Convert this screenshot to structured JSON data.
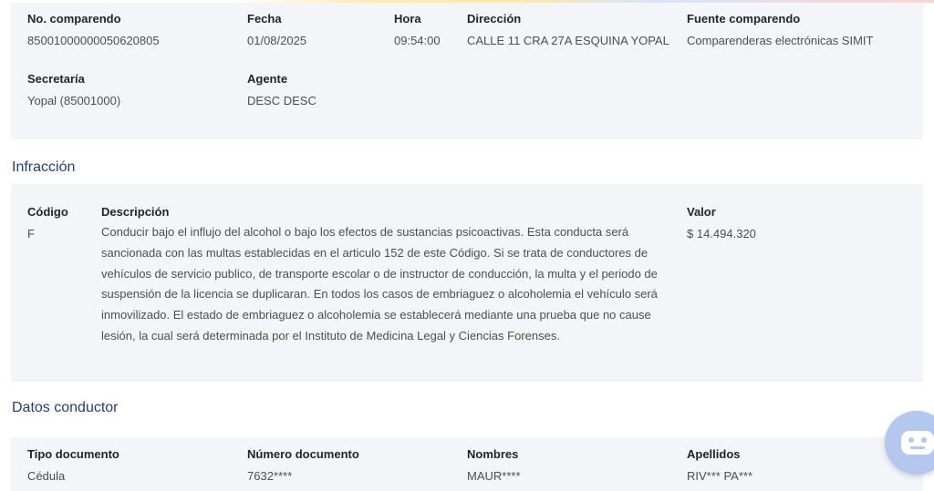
{
  "comparendo": {
    "numero_label": "No. comparendo",
    "numero_value": "85001000000050620805",
    "fecha_label": "Fecha",
    "fecha_value": "01/08/2025",
    "hora_label": "Hora",
    "hora_value": "09:54:00",
    "direccion_label": "Dirección",
    "direccion_value": "CALLE 11 CRA 27A ESQUINA YOPAL",
    "fuente_label": "Fuente comparendo",
    "fuente_value": "Comparenderas electrónicas SIMIT",
    "secretaria_label": "Secretaría",
    "secretaria_value": "Yopal (85001000)",
    "agente_label": "Agente",
    "agente_value": "DESC DESC"
  },
  "infraccion": {
    "title": "Infracción",
    "codigo_label": "Código",
    "codigo_value": "F",
    "descripcion_label": "Descripción",
    "descripcion_value": "Conducir bajo el influjo del alcohol o bajo los efectos de sustancias psicoactivas. Esta conducta será sancionada con las multas establecidas en el articulo 152 de este Código. Si se trata de conductores de vehículos de servicio publico, de transporte escolar o de instructor de conducción, la multa y el periodo de suspensión de la licencia se duplicaran. En todos los casos de embriaguez o alcoholemia el vehículo será inmovilizado. El estado de embriaguez o alcoholemia se establecerá mediante una prueba que no cause lesión, la cual será determinada por el Instituto de Medicina Legal y Ciencias Forenses.",
    "valor_label": "Valor",
    "valor_value": "$ 14.494.320"
  },
  "conductor": {
    "title": "Datos conductor",
    "tipo_documento_label": "Tipo documento",
    "tipo_documento_value": "Cédula",
    "numero_documento_label": "Número documento",
    "numero_documento_value": "7632****",
    "nombres_label": "Nombres",
    "nombres_value": "MAUR****",
    "apellidos_label": "Apellidos",
    "apellidos_value": "RIV*** PA***"
  },
  "chatbot": {
    "icon": "robot-icon",
    "color": "#b4c7ec"
  }
}
